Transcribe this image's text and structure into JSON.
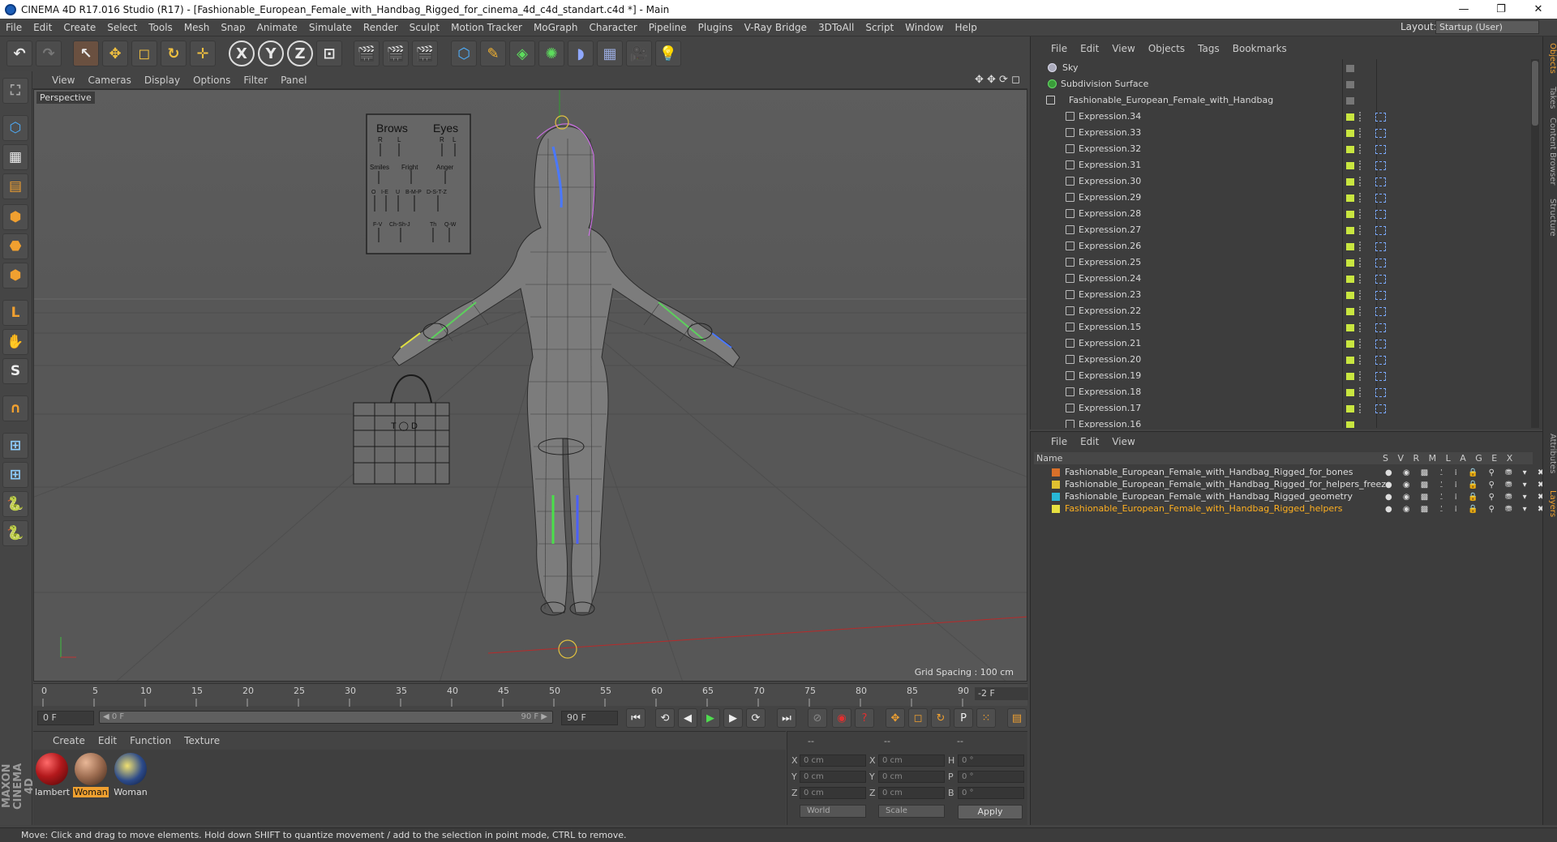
{
  "window": {
    "title": "CINEMA 4D R17.016 Studio (R17) - [Fashionable_European_Female_with_Handbag_Rigged_for_cinema_4d_c4d_standart.c4d *] - Main",
    "minimize": "—",
    "restore": "❐",
    "close": "✕"
  },
  "menubar": {
    "items": [
      "File",
      "Edit",
      "Create",
      "Select",
      "Tools",
      "Mesh",
      "Snap",
      "Animate",
      "Simulate",
      "Render",
      "Sculpt",
      "Motion Tracker",
      "MoGraph",
      "Character",
      "Pipeline",
      "Plugins",
      "V-Ray Bridge",
      "3DToAll",
      "Script",
      "Window",
      "Help"
    ],
    "layout_label": "Layout:",
    "layout_value": "Startup (User)"
  },
  "toolbar": {
    "undo": "↶",
    "redo": "↷",
    "select": "↖",
    "move": "✥",
    "scale": "◻",
    "rotate": "↻",
    "transform": "✛",
    "x_lock": "X",
    "y_lock": "Y",
    "z_lock": "Z",
    "coord": "⊡",
    "render_view": "🎬",
    "render_pic": "🎬",
    "render_settings": "🎬",
    "cube": "⬡",
    "pen": "✎",
    "subdiv": "◈",
    "array": "✺",
    "deformer": "◗",
    "floor": "▦",
    "camera": "🎥",
    "light": "💡"
  },
  "lefttools": {
    "icons": [
      "⛶",
      "⬡",
      "▦",
      "▤",
      "⬢",
      "⬣",
      "⬢",
      "L",
      "✋",
      "S",
      "∩",
      "⊞",
      "⊞",
      "🐍",
      "🐍"
    ]
  },
  "maxon": "MAXON CINEMA 4D",
  "viewport": {
    "menu": [
      "View",
      "Cameras",
      "Display",
      "Options",
      "Filter",
      "Panel"
    ],
    "ctl": "✥ ✥ ⟳ ◻",
    "label": "Perspective",
    "grid_spacing": "Grid Spacing : 100 cm",
    "head_panel": {
      "brows": "Brows",
      "eyes": "Eyes",
      "r": "R",
      "l": "L",
      "smiles": "Smiles",
      "fright": "Fright",
      "anger": "Anger",
      "row2": [
        "O",
        "I-E",
        "U",
        "B-M-P",
        "D-S-T-Z"
      ],
      "row3": [
        "F-V",
        "Ch-Sh-J",
        "Th",
        "Q-W"
      ]
    },
    "bag_tag": "T ◯ D"
  },
  "timeline": {
    "ticks": [
      "0",
      "5",
      "10",
      "15",
      "20",
      "25",
      "30",
      "35",
      "40",
      "45",
      "50",
      "55",
      "60",
      "65",
      "70",
      "75",
      "80",
      "85",
      "90"
    ],
    "frame_info": "-2 F",
    "start": "0 F",
    "slider_left": "◀ 0 F",
    "slider_right": "90 F ▶",
    "end": "90 F",
    "controls": [
      "⏮",
      "⟲",
      "◀",
      "▶",
      "▶",
      "⟳",
      "⏭"
    ],
    "record": [
      "⊘",
      "◉",
      "?",
      "✥",
      "◻",
      "↻",
      "P",
      "⁙",
      "▤"
    ]
  },
  "materials": {
    "menu": [
      "Create",
      "Edit",
      "Function",
      "Texture"
    ],
    "items": [
      {
        "label": "lambert",
        "color": "#b3191c"
      },
      {
        "label": "Woman",
        "color": "#9a6a4e"
      },
      {
        "label": "Woman",
        "color": "#2c4a8a"
      }
    ]
  },
  "coords": {
    "headers": [
      "--",
      "--",
      "--"
    ],
    "rows": [
      {
        "a": "X",
        "av": "0 cm",
        "b": "X",
        "bv": "0 cm",
        "c": "H",
        "cv": "0 °"
      },
      {
        "a": "Y",
        "av": "0 cm",
        "b": "Y",
        "bv": "0 cm",
        "c": "P",
        "cv": "0 °"
      },
      {
        "a": "Z",
        "av": "0 cm",
        "b": "Z",
        "bv": "0 cm",
        "c": "B",
        "cv": "0 °"
      }
    ],
    "world": "World",
    "scale": "Scale",
    "apply": "Apply"
  },
  "status": "Move: Click and drag to move elements. Hold down SHIFT to quantize movement / add to the selection in point mode, CTRL to remove.",
  "objects": {
    "menu": [
      "File",
      "Edit",
      "View",
      "Objects",
      "Tags",
      "Bookmarks"
    ],
    "top": [
      {
        "name": "Sky"
      },
      {
        "name": "Subdivision Surface"
      },
      {
        "name": "Fashionable_European_Female_with_Handbag"
      }
    ],
    "expressions": [
      "Expression.34",
      "Expression.33",
      "Expression.32",
      "Expression.31",
      "Expression.30",
      "Expression.29",
      "Expression.28",
      "Expression.27",
      "Expression.26",
      "Expression.25",
      "Expression.24",
      "Expression.23",
      "Expression.22",
      "Expression.15",
      "Expression.21",
      "Expression.20",
      "Expression.19",
      "Expression.18",
      "Expression.17",
      "Expression.16"
    ]
  },
  "layers": {
    "menu": [
      "File",
      "Edit",
      "View"
    ],
    "header_name": "Name",
    "header_flags": "S V R M L A G E X",
    "rows": [
      {
        "name": "Fashionable_European_Female_with_Handbag_Rigged_for_bones",
        "color": "#d8702a",
        "text": "#dddddd"
      },
      {
        "name": "Fashionable_European_Female_with_Handbag_Rigged_for_helpers_freez",
        "color": "#e0c030",
        "text": "#dddddd"
      },
      {
        "name": "Fashionable_European_Female_with_Handbag_Rigged_geometry",
        "color": "#29b7d6",
        "text": "#dddddd"
      },
      {
        "name": "Fashionable_European_Female_with_Handbag_Rigged_helpers",
        "color": "#e6e040",
        "text": "#ffb020"
      }
    ],
    "flags": "● ◉ ▩ ⍘ ⁞ 🔒 ⚲ ⛃ ▾ ✖"
  },
  "sidetabs": [
    "Objects",
    "Takes",
    "Content Browser",
    "Structure",
    "Attributes",
    "Layers"
  ]
}
